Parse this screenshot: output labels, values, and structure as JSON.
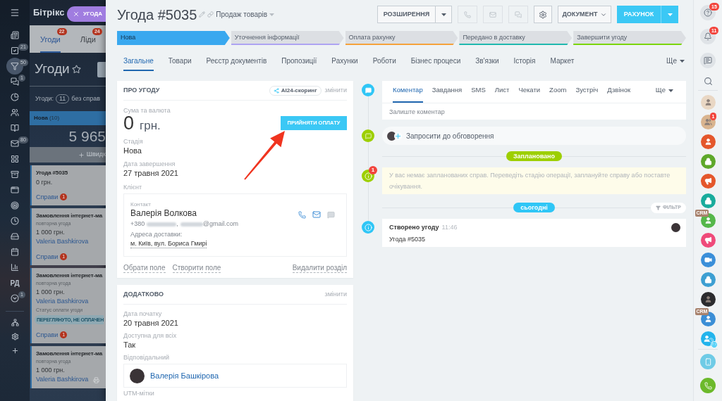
{
  "close_button": {
    "label": "УГОДА"
  },
  "left_menu": {
    "items": [
      {
        "kind": "feed",
        "selected": false
      },
      {
        "kind": "tasks",
        "badge": "21",
        "selected": false
      },
      {
        "kind": "crm",
        "badge": "50",
        "selected": true
      },
      {
        "kind": "chat",
        "badge": "1",
        "selected": false
      },
      {
        "kind": "time",
        "selected": false
      },
      {
        "kind": "people",
        "selected": false
      },
      {
        "kind": "knowledge",
        "selected": false
      },
      {
        "kind": "mail",
        "badge": "80",
        "selected": false
      },
      {
        "kind": "apps",
        "selected": false
      },
      {
        "kind": "shop",
        "selected": false
      },
      {
        "kind": "sites",
        "selected": false
      },
      {
        "kind": "goals",
        "selected": false
      },
      {
        "kind": "clock",
        "selected": false
      },
      {
        "kind": "drive",
        "selected": false
      },
      {
        "kind": "calendar",
        "selected": false
      },
      {
        "kind": "reports",
        "selected": false
      },
      {
        "kind": "text",
        "label": "РД",
        "selected": false
      },
      {
        "kind": "more",
        "badge": "1",
        "selected": false
      }
    ],
    "bottom_items": [
      {
        "kind": "structure"
      },
      {
        "kind": "settings"
      },
      {
        "kind": "add"
      }
    ]
  },
  "background_page": {
    "logo": "Бітрікс",
    "tabs": [
      {
        "label": "Угоди",
        "badge": "22",
        "selected": true
      },
      {
        "label": "Ліди",
        "badge": "24",
        "selected": false
      }
    ],
    "title": "Угоди",
    "summary": {
      "label": "Угоди:",
      "count": "11",
      "note": "без справ"
    },
    "column": {
      "name": "Нова",
      "count": "(10)",
      "total": "5 965",
      "quick_add": "Швидк"
    },
    "cards": [
      {
        "title": "Угода #5035",
        "amount": "0 грн.",
        "tasks": "Справи",
        "tasks_count": "1"
      },
      {
        "title": "Замовлення інтернет-ма",
        "subtitle": "повторна угода",
        "amount": "1 000 грн.",
        "person": "Valeria Bashkirova",
        "tasks": "Справи",
        "tasks_count": "1"
      },
      {
        "title": "Замовлення інтернет-ма",
        "subtitle": "повторна угода",
        "amount": "1 000 грн.",
        "person": "Valeria Bashkirova",
        "field_label": "Статус оплати угоди",
        "status": "ПЕРЕГЛЯНУТО, НЕ ОПЛАЧЕН",
        "tasks": "Справи",
        "tasks_count": "1"
      },
      {
        "title": "Замовлення інтернет-ма",
        "subtitle": "повторна угода",
        "amount": "1 000 грн.",
        "person": "Valeria Bashkirova",
        "print": true
      }
    ]
  },
  "deal": {
    "title": "Угода #5035",
    "category": "Продаж товарів"
  },
  "toolbar": {
    "extensions": "РОЗШИРЕННЯ",
    "document": "ДОКУМЕНТ",
    "invoice": "РАХУНОК"
  },
  "stages": [
    {
      "label": "Нова",
      "color": "#39a8ef",
      "selected": true
    },
    {
      "label": "Уточнення інформації",
      "color": "#aea4f2",
      "selected": false
    },
    {
      "label": "Оплата рахунку",
      "color": "#f5a23b",
      "selected": false
    },
    {
      "label": "Передано в доставку",
      "color": "#20b8ae",
      "selected": false
    },
    {
      "label": "Завершити угоду",
      "color": "#7bd500",
      "selected": false
    }
  ],
  "tabs": [
    {
      "label": "Загальне",
      "selected": true
    },
    {
      "label": "Товари",
      "selected": false
    },
    {
      "label": "Реєстр документів",
      "selected": false
    },
    {
      "label": "Пропозиції",
      "selected": false
    },
    {
      "label": "Рахунки",
      "selected": false
    },
    {
      "label": "Роботи",
      "selected": false
    },
    {
      "label": "Бізнес процеси",
      "selected": false
    },
    {
      "label": "Зв'язки",
      "selected": false
    },
    {
      "label": "Історія",
      "selected": false
    },
    {
      "label": "Маркет",
      "selected": false
    }
  ],
  "tabs_more": "Ще",
  "about": {
    "title": "ПРО УГОДУ",
    "scoring": "AI24-скоринг",
    "edit": "змінити",
    "amount_label": "Сума та валюта",
    "amount": "0",
    "currency": "грн.",
    "accept_payment": "ПРИЙНЯТИ ОПЛАТУ",
    "fields": [
      {
        "label": "Стадія",
        "value": "Нова"
      },
      {
        "label": "Дата завершення",
        "value": "27 травня 2021"
      }
    ],
    "client": {
      "label": "Клієнт",
      "contact_label": "Контакт",
      "name": "Валерія Волкова",
      "phone": "+380",
      "separator": ",",
      "email_domain": "@gmail.com",
      "address_label": "Адреса доставки:",
      "address": "м. Київ, вул. Бориса Гмирі"
    },
    "links": [
      "Обрати поле",
      "Створити поле"
    ],
    "delete_link": "Видалити розділ"
  },
  "additional": {
    "title": "ДОДАТКОВО",
    "edit": "змінити",
    "fields": [
      {
        "label": "Дата початку",
        "value": "20 травня 2021"
      },
      {
        "label": "Доступна для всіх",
        "value": "Так"
      }
    ],
    "responsible": {
      "label": "Відповідальний",
      "name": "Валерія Башкірова"
    },
    "utm_label": "UTM-мітки"
  },
  "timeline": {
    "tabs": [
      {
        "label": "Коментар",
        "selected": true
      },
      {
        "label": "Завдання",
        "selected": false
      },
      {
        "label": "SMS",
        "selected": false
      },
      {
        "label": "Лист",
        "selected": false
      },
      {
        "label": "Чекати",
        "selected": false
      },
      {
        "label": "Zoom",
        "selected": false
      },
      {
        "label": "Зустріч",
        "selected": false
      },
      {
        "label": "Дзвінок",
        "selected": false
      }
    ],
    "tabs_more": "Ще",
    "comment_placeholder": "Залиште коментар",
    "invite": "Запросити до обговорення",
    "planned": "Заплановано",
    "notice": "У вас немає запланованих справ. Переведіть стадію операції, заплануйте справу або поставте очікування.",
    "notice_badge": "1",
    "today": "сьогодні",
    "filter": "ФІЛЬТР",
    "event": {
      "title": "Створено угоду",
      "time": "11:46",
      "text": "Угода #5035"
    }
  },
  "right_bar": {
    "top": [
      {
        "kind": "help",
        "badge": "15"
      },
      {
        "kind": "notifications",
        "badge": "11"
      },
      {
        "kind": "messages"
      },
      {
        "kind": "search"
      }
    ],
    "chats": [
      {
        "kind": "photo",
        "color": "#e9d7c4"
      },
      {
        "kind": "group",
        "color": "#d9b48f",
        "badge": "1"
      },
      {
        "kind": "user",
        "color": "#e4572c"
      },
      {
        "kind": "lock",
        "color": "#5ea82a"
      },
      {
        "kind": "megaphone",
        "color": "#e4572c"
      },
      {
        "kind": "lock",
        "color": "#19ab9c"
      },
      {
        "kind": "user",
        "color": "#55b74a",
        "tag": "CRM"
      },
      {
        "kind": "megaphone",
        "color": "#ef4a7a"
      },
      {
        "kind": "video",
        "color": "#3b8fd9"
      },
      {
        "kind": "lock",
        "color": "#3d9fd2"
      },
      {
        "kind": "photo",
        "color": "#2b2b2e"
      },
      {
        "kind": "user",
        "color": "#3b8ed6",
        "tag": "CRM"
      },
      {
        "kind": "user-clock",
        "color": "#23b4ec"
      }
    ],
    "bottom": [
      {
        "kind": "phone-cloud"
      },
      {
        "kind": "call"
      }
    ]
  }
}
